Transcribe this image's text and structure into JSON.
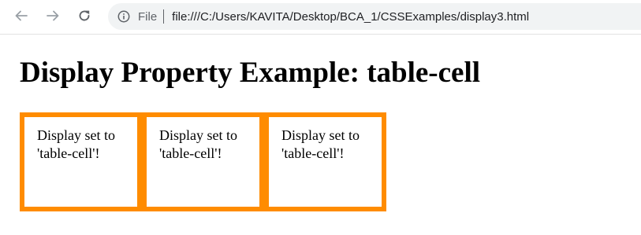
{
  "browser": {
    "scheme_label": "File",
    "url": "file:///C:/Users/KAVITA/Desktop/BCA_1/CSSExamples/display3.html",
    "icons": [
      "back-arrow-icon",
      "forward-arrow-icon",
      "reload-icon",
      "info-icon"
    ]
  },
  "page": {
    "title": "Display Property Example: table-cell",
    "cells": [
      {
        "text": "Display set to 'table-cell'!"
      },
      {
        "text": "Display set to 'table-cell'!"
      },
      {
        "text": "Display set to 'table-cell'!"
      }
    ],
    "colors": {
      "border": "#ff8c00",
      "cell_background": "#ffffff"
    }
  }
}
